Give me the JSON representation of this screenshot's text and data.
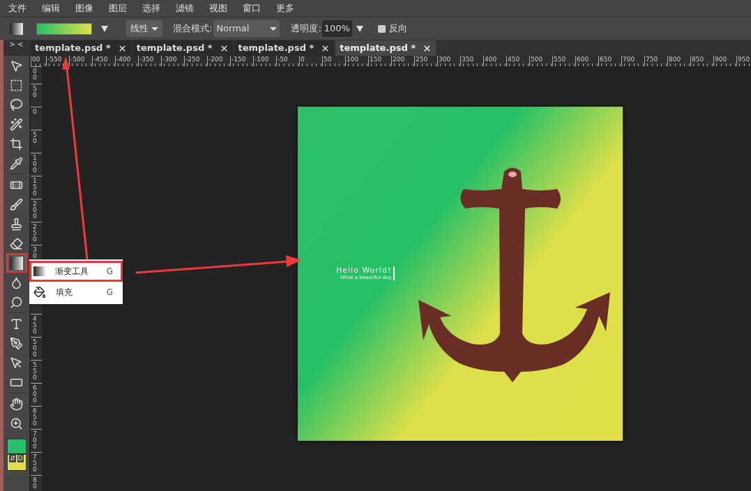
{
  "menu": [
    "文件",
    "编辑",
    "图像",
    "图层",
    "选择",
    "滤镜",
    "视图",
    "窗口",
    "更多"
  ],
  "options_bar": {
    "gradient_type": "线性",
    "blend_label": "混合模式:",
    "blend_value": "Normal",
    "opacity_label": "透明度:",
    "opacity_value": "100%",
    "reverse": {
      "label": "反向",
      "checked": false
    }
  },
  "toolbar": {
    "collapse": "> <",
    "tools": [
      {
        "kind": "move",
        "selected": false
      },
      {
        "kind": "marquee",
        "selected": false
      },
      {
        "kind": "lasso",
        "selected": false
      },
      {
        "kind": "wand",
        "selected": false
      },
      {
        "kind": "crop",
        "selected": false
      },
      {
        "kind": "eyedropper",
        "selected": false
      },
      {
        "kind": "healing",
        "selected": false
      },
      {
        "kind": "brush",
        "selected": false
      },
      {
        "kind": "stamp",
        "selected": false
      },
      {
        "kind": "eraser",
        "selected": false
      },
      {
        "kind": "gradient",
        "selected": true
      },
      {
        "kind": "blur",
        "selected": false
      },
      {
        "kind": "dodge",
        "selected": false
      },
      {
        "kind": "type",
        "selected": false
      },
      {
        "kind": "pen",
        "selected": false
      },
      {
        "kind": "path-select",
        "selected": false
      },
      {
        "kind": "rectangle",
        "selected": false
      },
      {
        "kind": "hand",
        "selected": false
      },
      {
        "kind": "zoom",
        "selected": false
      }
    ],
    "swap": "⇵",
    "default": "D"
  },
  "tabs": [
    {
      "label": "template.psd *",
      "selected": false
    },
    {
      "label": "template.psd *",
      "selected": false
    },
    {
      "label": "template.psd *",
      "selected": false
    },
    {
      "label": "template.psd *",
      "selected": true
    }
  ],
  "ruler_h": [
    "00",
    "-550",
    "-500",
    "-450",
    "-400",
    "-350",
    "-300",
    "-250",
    "-200",
    "-150",
    "-100",
    "-50",
    "0",
    "50",
    "100",
    "150",
    "200",
    "250",
    "300",
    "350",
    "400",
    "450",
    "500",
    "550",
    "600",
    "650",
    "700",
    "750",
    "800",
    "850",
    "900",
    "950"
  ],
  "ruler_v": [
    "00",
    "50",
    "0",
    "50",
    "100",
    "150",
    "200",
    "250",
    "30"
  ],
  "ruler_v_lower": [
    "450",
    "500",
    "550",
    "600",
    "650",
    "700",
    "750",
    "80"
  ],
  "canvas": {
    "title": "Hello World!",
    "subtitle": "What a beautiful day"
  },
  "flyout": [
    {
      "kind": "gradient",
      "label": "渐变工具",
      "shortcut": "G",
      "selected": true
    },
    {
      "kind": "fill",
      "label": "填充",
      "shortcut": "G",
      "selected": false
    }
  ]
}
